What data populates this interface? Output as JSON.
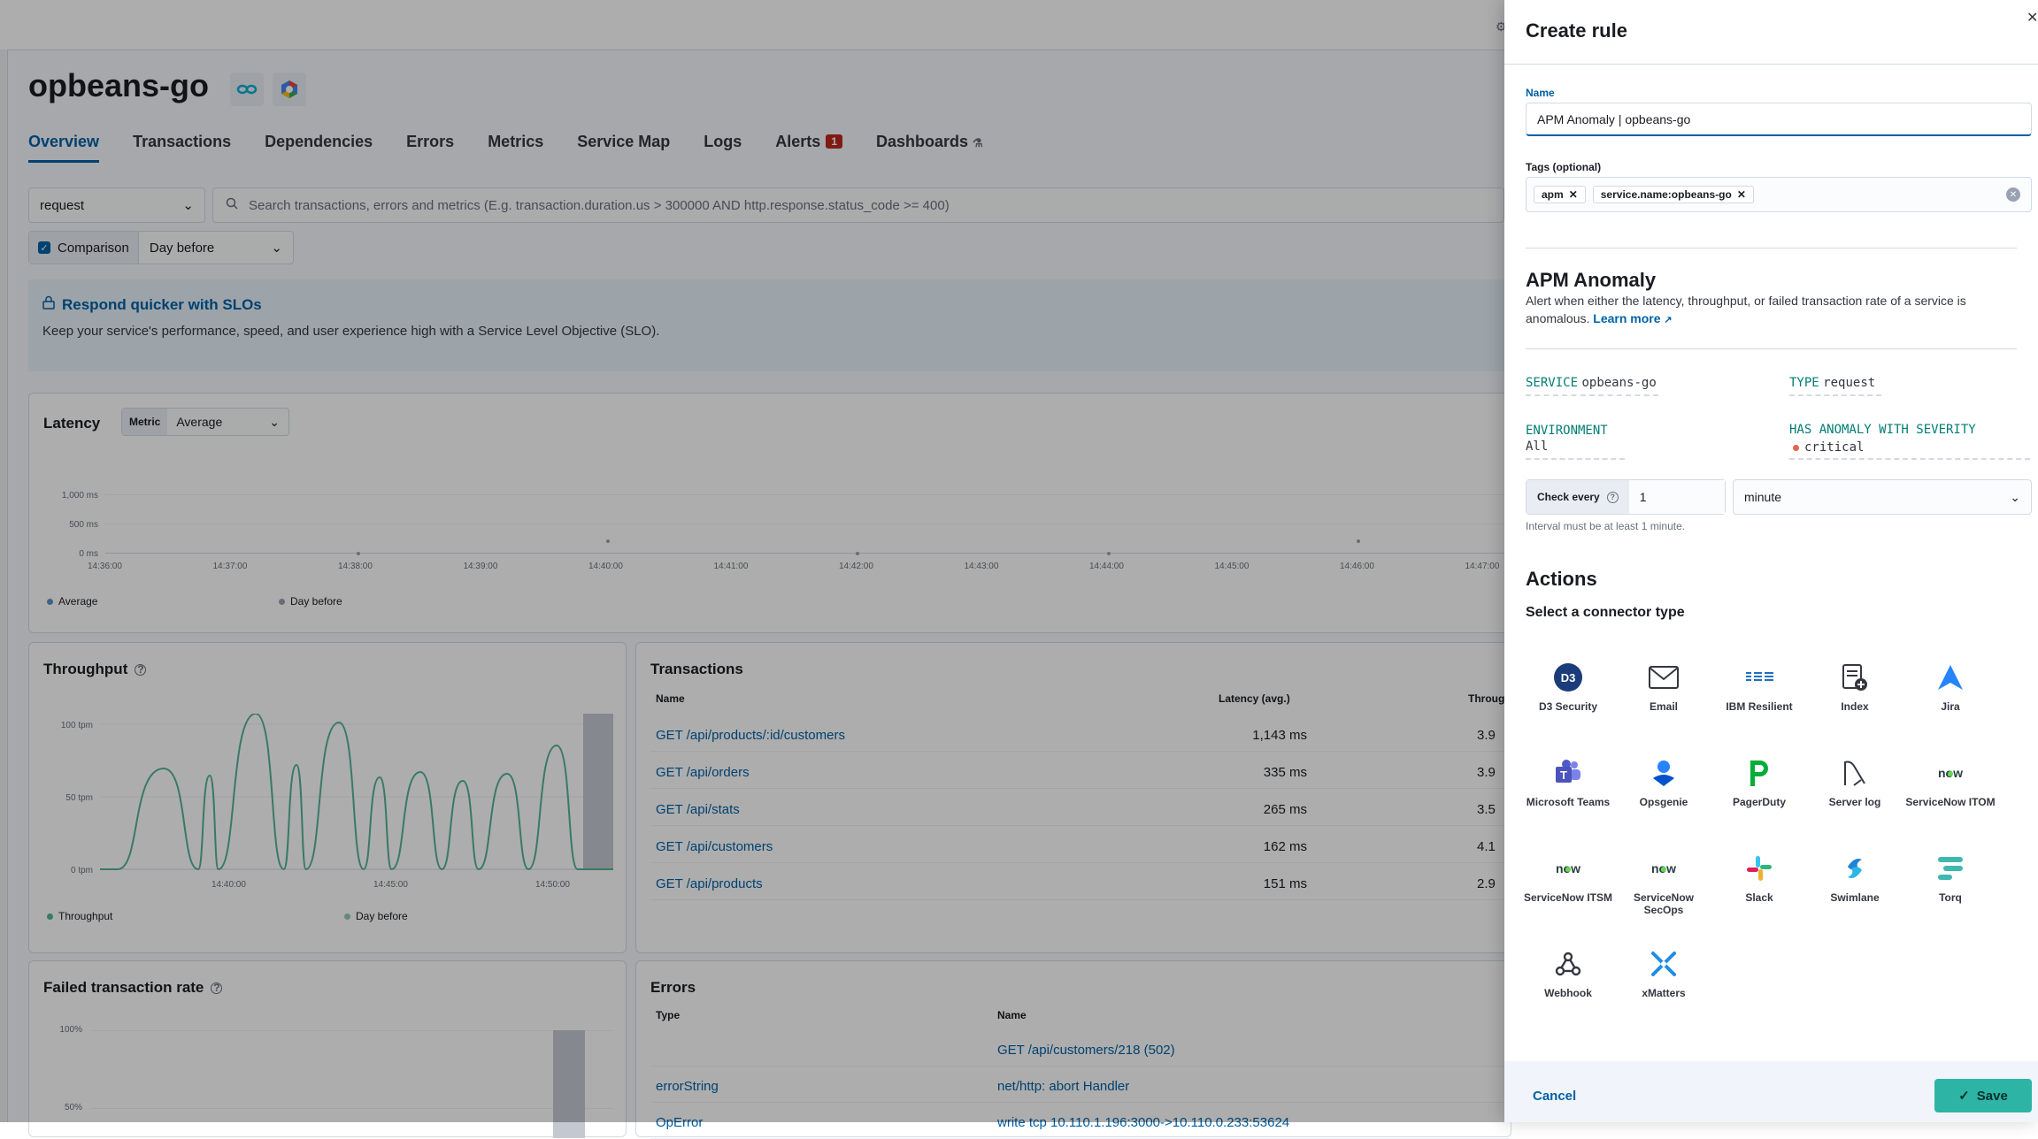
{
  "service": {
    "name": "opbeans-go",
    "tabs": [
      "Overview",
      "Transactions",
      "Dependencies",
      "Errors",
      "Metrics",
      "Service Map",
      "Logs",
      "Alerts",
      "Dashboards"
    ],
    "alerts_count": "1",
    "transaction_type_select": "request",
    "search_placeholder": "Search transactions, errors and metrics (E.g. transaction.duration.us > 300000 AND http.response.status_code >= 400)",
    "comparison_label": "Comparison",
    "comparison_value": "Day before"
  },
  "callout": {
    "title": "Respond quicker with SLOs",
    "text": "Keep your service's performance, speed, and user experience high with a Service Level Objective (SLO)."
  },
  "latency": {
    "title": "Latency",
    "metric_label": "Metric",
    "metric_value": "Average",
    "yticks": [
      "1,000 ms",
      "500 ms",
      "0 ms"
    ],
    "xticks": [
      "14:36:00",
      "14:37:00",
      "14:38:00",
      "14:39:00",
      "14:40:00",
      "14:41:00",
      "14:42:00",
      "14:43:00",
      "14:44:00",
      "14:45:00",
      "14:46:00",
      "14:47:00"
    ],
    "legend": [
      "Average",
      "Day before"
    ]
  },
  "throughput": {
    "title": "Throughput",
    "yticks": [
      "100 tpm",
      "50 tpm",
      "0 tpm"
    ],
    "xticks": [
      "14:40:00",
      "14:45:00",
      "14:50:00"
    ],
    "legend": [
      "Throughput",
      "Day before"
    ]
  },
  "transactions": {
    "title": "Transactions",
    "col_name": "Name",
    "col_latency": "Latency (avg.)",
    "col_throughput": "Throug",
    "rows": [
      {
        "name": "GET /api/products/:id/customers",
        "latency": "1,143 ms",
        "throughput": "3.9"
      },
      {
        "name": "GET /api/orders",
        "latency": "335 ms",
        "throughput": "3.9"
      },
      {
        "name": "GET /api/stats",
        "latency": "265 ms",
        "throughput": "3.5"
      },
      {
        "name": "GET /api/customers",
        "latency": "162 ms",
        "throughput": "4.1"
      },
      {
        "name": "GET /api/products",
        "latency": "151 ms",
        "throughput": "2.9"
      }
    ]
  },
  "failed_rate": {
    "title": "Failed transaction rate",
    "yticks": [
      "100%",
      "50%"
    ]
  },
  "errors": {
    "title": "Errors",
    "col_type": "Type",
    "col_name": "Name",
    "rows": [
      {
        "type": "",
        "name": "GET /api/customers/218 (502)"
      },
      {
        "type": "errorString",
        "name": "net/http: abort Handler"
      },
      {
        "type": "OpError",
        "name": "write tcp 10.110.1.196:3000->10.110.0.233:53624"
      }
    ]
  },
  "flyout": {
    "title": "Create rule",
    "name_label": "Name",
    "name_value": "APM Anomaly | opbeans-go",
    "tags_label": "Tags (optional)",
    "tags": [
      "apm",
      "service.name:opbeans-go"
    ],
    "rule_title": "APM Anomaly",
    "rule_desc": "Alert when either the latency, throughput, or failed transaction rate of a service is anomalous.",
    "learn_more": "Learn more",
    "expr_service_key": "SERVICE",
    "expr_service_val": "opbeans-go",
    "expr_type_key": "TYPE",
    "expr_type_val": "request",
    "expr_env_key": "ENVIRONMENT",
    "expr_env_val": "All",
    "expr_sev_key": "HAS ANOMALY WITH SEVERITY",
    "expr_sev_val": "critical",
    "check_every_label": "Check every",
    "check_every_value": "1",
    "check_unit": "minute",
    "interval_help": "Interval must be at least 1 minute.",
    "actions_title": "Actions",
    "connector_subtitle": "Select a connector type",
    "connectors": [
      {
        "label": "D3 Security",
        "icon": "d3-security-icon"
      },
      {
        "label": "Email",
        "icon": "email-icon"
      },
      {
        "label": "IBM Resilient",
        "icon": "ibm-resilient-icon"
      },
      {
        "label": "Index",
        "icon": "index-icon"
      },
      {
        "label": "Jira",
        "icon": "jira-icon"
      },
      {
        "label": "Microsoft Teams",
        "icon": "microsoft-teams-icon"
      },
      {
        "label": "Opsgenie",
        "icon": "opsgenie-icon"
      },
      {
        "label": "PagerDuty",
        "icon": "pagerduty-icon"
      },
      {
        "label": "Server log",
        "icon": "server-log-icon"
      },
      {
        "label": "ServiceNow ITOM",
        "icon": "servicenow-itom-icon"
      },
      {
        "label": "ServiceNow ITSM",
        "icon": "servicenow-itsm-icon"
      },
      {
        "label": "ServiceNow SecOps",
        "icon": "servicenow-secops-icon"
      },
      {
        "label": "Slack",
        "icon": "slack-icon"
      },
      {
        "label": "Swimlane",
        "icon": "swimlane-icon"
      },
      {
        "label": "Torq",
        "icon": "torq-icon"
      },
      {
        "label": "Webhook",
        "icon": "webhook-icon"
      },
      {
        "label": "xMatters",
        "icon": "xmatters-icon"
      }
    ],
    "cancel_label": "Cancel",
    "save_label": "Save"
  },
  "colors": {
    "accent": "#0061a6",
    "save": "#2db4a5",
    "expr_key": "#017d73",
    "throughput_line": "#54b399"
  }
}
